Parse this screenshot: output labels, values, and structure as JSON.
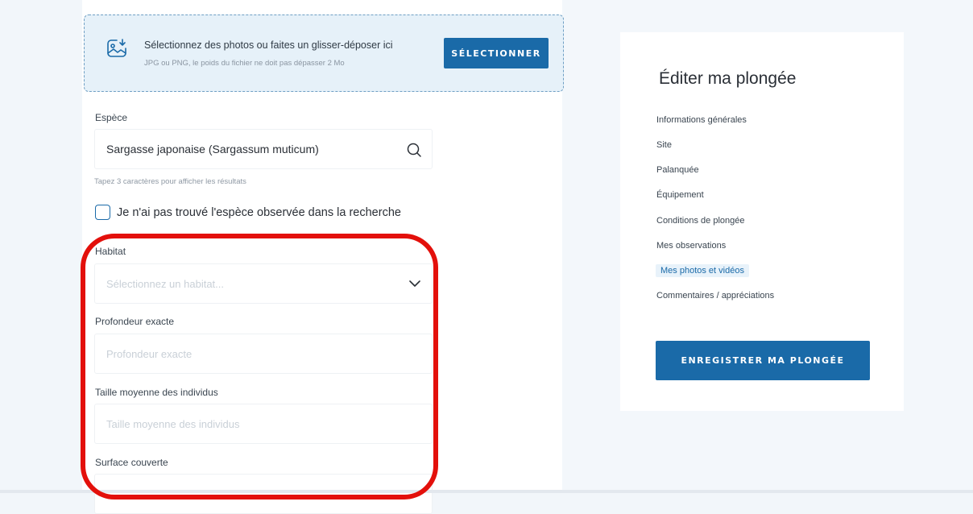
{
  "upload": {
    "main_text": "Sélectionnez des photos ou faites un glisser-déposer ici",
    "hint_text": "JPG ou PNG, le poids du fichier ne doit pas dépasser 2 Mo",
    "button_label": "SÉLECTIONNER"
  },
  "species": {
    "label": "Espèce",
    "value": "Sargasse japonaise (Sargassum muticum)",
    "hint": "Tapez 3 caractères pour afficher les résultats"
  },
  "not_found": {
    "label": "Je n'ai pas trouvé l'espèce observée dans la recherche",
    "checked": false
  },
  "habitat": {
    "label": "Habitat",
    "placeholder": "Sélectionnez un habitat..."
  },
  "depth": {
    "label": "Profondeur exacte",
    "placeholder": "Profondeur exacte"
  },
  "size": {
    "label": "Taille moyenne des individus",
    "placeholder": "Taille moyenne des individus"
  },
  "surface": {
    "label": "Surface couverte"
  },
  "panel": {
    "title": "Éditer ma plongée",
    "nav": [
      "Informations générales",
      "Site",
      "Palanquée",
      "Équipement",
      "Conditions de plongée",
      "Mes observations",
      "Mes photos et vidéos",
      "Commentaires / appréciations"
    ],
    "active_index": 6,
    "save_label": "ENREGISTRER MA PLONGÉE"
  },
  "colors": {
    "accent": "#1a6aa8",
    "highlight": "#e3100b"
  }
}
